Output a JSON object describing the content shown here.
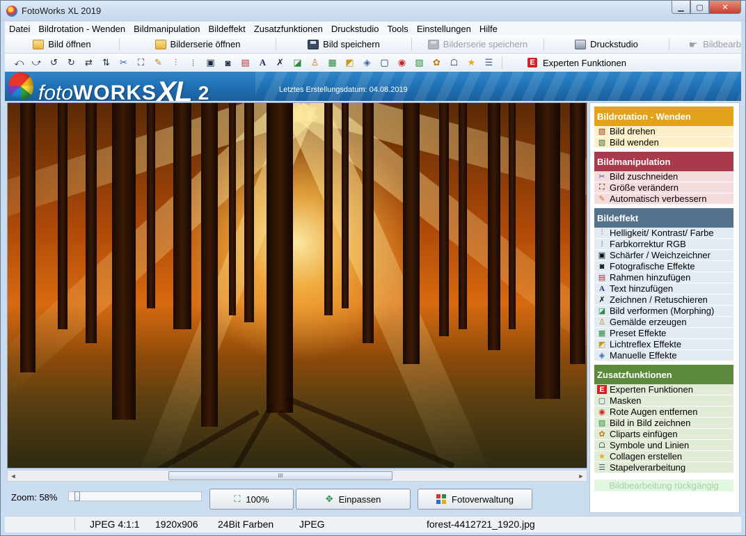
{
  "window": {
    "title": "FotoWorks XL 2019",
    "minimize": "▁",
    "maximize": "▢",
    "close": "✕"
  },
  "menu": [
    "Datei",
    "Bildrotation - Wenden",
    "Bildmanipulation",
    "Bildeffekt",
    "Zusatzfunktionen",
    "Druckstudio",
    "Tools",
    "Einstellungen",
    "Hilfe"
  ],
  "toolbar1": {
    "open_image": "Bild öffnen",
    "open_series": "Bilderserie öffnen",
    "save_image": "Bild speichern",
    "save_series": "Bilderserie speichern",
    "print_studio": "Druckstudio",
    "edit": "Bildbearb"
  },
  "toolbar2": {
    "icons": [
      "rotate-left-icon",
      "rotate-right-icon",
      "turn-left-icon",
      "turn-right-icon",
      "mirror-icon",
      "flip-icon",
      "scissors-icon",
      "resize-icon",
      "magic-wand-icon",
      "sliders-icon",
      "rgb-icon",
      "sharpen-icon",
      "camera-icon",
      "frame-icon",
      "text-icon",
      "brush-icon",
      "morph-icon",
      "paint-icon",
      "preset-icon",
      "lens-flare-icon",
      "manual-effects-icon",
      "mask-icon",
      "red-eye-icon",
      "picture-in-picture-icon",
      "clipart-icon",
      "symbols-icon",
      "star-icon",
      "batch-icon"
    ],
    "experten_badge": "E",
    "experten_label": "Experten Funktionen"
  },
  "banner": {
    "brand_light": "foto",
    "brand_bold": "WORKS",
    "brand_xl": "XL",
    "brand_version": "2",
    "created_label": "Letztes Erstellungsdatum: 04.08.2019"
  },
  "scrollbar": {
    "left_arrow": "◄",
    "right_arrow": "►",
    "thumb_grip": "III"
  },
  "bottom": {
    "zoom_label": "Zoom: 58%",
    "zoom_value": 0.58,
    "btn_100": "100%",
    "btn_fit": "Einpassen",
    "btn_manager": "Fotoverwaltung"
  },
  "panel": {
    "sections": [
      {
        "title": "Bildrotation - Wenden",
        "color": "#e2a21a",
        "item_bg": "#fdf0c8",
        "items": [
          {
            "label": "Bild drehen",
            "icon": "rotate-icon"
          },
          {
            "label": "Bild wenden",
            "icon": "flip-icon"
          }
        ]
      },
      {
        "title": "Bildmanipulation",
        "color": "#a83a4c",
        "item_bg": "#f5dcdc",
        "items": [
          {
            "label": "Bild zuschneiden",
            "icon": "scissors-icon"
          },
          {
            "label": "Größe verändern",
            "icon": "resize-icon"
          },
          {
            "label": "Automatisch verbessern",
            "icon": "magic-wand-icon"
          }
        ]
      },
      {
        "title": "Bildeffekt",
        "color": "#55728c",
        "item_bg": "#e2eaf2",
        "items": [
          {
            "label": "Helligkeit/ Kontrast/ Farbe",
            "icon": "sliders-icon"
          },
          {
            "label": "Farbkorrektur RGB",
            "icon": "rgb-icon"
          },
          {
            "label": "Schärfer / Weichzeichner",
            "icon": "sharpen-icon"
          },
          {
            "label": "Fotografische Effekte",
            "icon": "camera-icon"
          },
          {
            "label": "Rahmen hinzufügen",
            "icon": "frame-icon"
          },
          {
            "label": "Text hinzufügen",
            "icon": "text-icon"
          },
          {
            "label": "Zeichnen / Retuschieren",
            "icon": "brush-icon"
          },
          {
            "label": "Bild verformen (Morphing)",
            "icon": "morph-icon"
          },
          {
            "label": "Gemälde erzeugen",
            "icon": "paint-icon"
          },
          {
            "label": "Preset Effekte",
            "icon": "preset-icon"
          },
          {
            "label": "Lichtreflex Effekte",
            "icon": "lens-flare-icon"
          },
          {
            "label": "Manuelle Effekte",
            "icon": "manual-effects-icon"
          }
        ]
      },
      {
        "title": "Zusatzfunktionen",
        "color": "#5b8a3c",
        "item_bg": "#e0ecd6",
        "items": [
          {
            "label": "Experten Funktionen",
            "icon": "experten-icon"
          },
          {
            "label": "Masken",
            "icon": "mask-icon"
          },
          {
            "label": "Rote Augen entfernen",
            "icon": "red-eye-icon"
          },
          {
            "label": "Bild in Bild zeichnen",
            "icon": "picture-in-picture-icon"
          },
          {
            "label": "Cliparts einfügen",
            "icon": "clipart-icon"
          },
          {
            "label": "Symbole und Linien",
            "icon": "symbols-icon"
          },
          {
            "label": "Collagen erstellen",
            "icon": "star-icon"
          },
          {
            "label": "Stapelverarbeitung",
            "icon": "batch-icon"
          }
        ]
      }
    ],
    "undo": "Bildbearbeitung rückgängig"
  },
  "status": {
    "format": "JPEG  4:1:1",
    "dimensions": "1920x906",
    "colors": "24Bit Farben",
    "type": "JPEG",
    "filename": "forest-4412721_1920.jpg"
  }
}
